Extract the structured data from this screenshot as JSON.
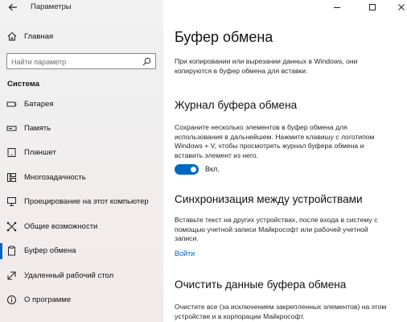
{
  "window": {
    "title": "Параметры",
    "controls": [
      "minimize-icon",
      "maximize-icon",
      "close-icon"
    ]
  },
  "sidebar": {
    "home_label": "Главная",
    "search_placeholder": "Найти параметр",
    "section_label": "Система",
    "items": [
      {
        "label": "Батарея",
        "icon": "battery-icon",
        "active": false
      },
      {
        "label": "Память",
        "icon": "storage-icon",
        "active": false
      },
      {
        "label": "Планшет",
        "icon": "tablet-icon",
        "active": false
      },
      {
        "label": "Многозадачность",
        "icon": "multitasking-icon",
        "active": false
      },
      {
        "label": "Проецирование на этот компьютер",
        "icon": "projecting-icon",
        "active": false
      },
      {
        "label": "Общие возможности",
        "icon": "shared-experiences-icon",
        "active": false
      },
      {
        "label": "Буфер обмена",
        "icon": "clipboard-icon",
        "active": true
      },
      {
        "label": "Удаленный рабочий стол",
        "icon": "remote-desktop-icon",
        "active": false
      },
      {
        "label": "О программе",
        "icon": "info-icon",
        "active": false
      }
    ]
  },
  "main": {
    "title": "Буфер обмена",
    "intro_lines": [
      "При копировании или вырезании данных в Windows, они",
      "копируются в буфер обмена для вставки."
    ],
    "history": {
      "heading": "Журнал буфера обмена",
      "desc_lines": [
        "Сохраните несколько элементов в буфер обмена для",
        "использования в дальнейшем. Нажмите клавишу с логотипом",
        "Windows + V, чтобы просмотреть журнал буфера обмена и",
        "вставить элемент из него."
      ],
      "toggle_label": "Вкл.",
      "toggle_on": true
    },
    "sync": {
      "heading": "Синхронизация между устройствами",
      "desc_lines": [
        "Вставьте текст на других устройствах, после входа в систему с",
        "помощью учетной записи Майкрософт или рабочей учетной",
        "записи."
      ],
      "link": "Войти"
    },
    "clear": {
      "heading": "Очистить данные буфера обмена",
      "desc_lines": [
        "Очистите все (за исключением закрепленных элементов) на этом",
        "устройстве и в корпорации Майкрософт."
      ]
    }
  },
  "colors": {
    "accent": "#0067c0",
    "sidebar_bg": "#f2f2f2",
    "main_bg": "#ffffff"
  }
}
